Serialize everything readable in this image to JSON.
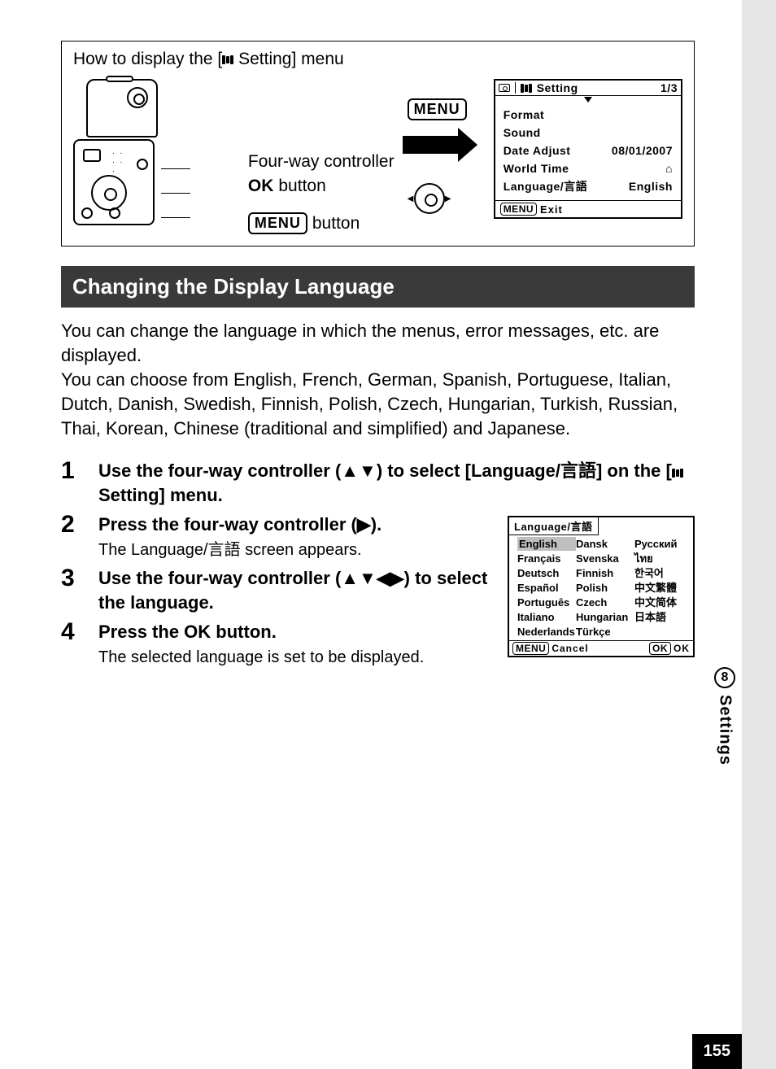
{
  "diagram": {
    "title_prefix": "How to display the [",
    "title_suffix": " Setting] menu",
    "controller_label": "Four-way controller",
    "ok_button_label": " button",
    "ok_glyph": "OK",
    "menu_button_label": " button",
    "menu_glyph": "MENU"
  },
  "setting_menu": {
    "title": "Setting",
    "page_indicator": "1/3",
    "items": {
      "format": "Format",
      "sound": "Sound",
      "date_adjust": "Date Adjust",
      "date_value": "08/01/2007",
      "world_time": "World Time",
      "language_label": "Language/言語",
      "language_value": "English"
    },
    "footer_label": "Exit",
    "footer_badge": "MENU"
  },
  "section_heading": "Changing the Display Language",
  "intro_p1": "You can change the language in which the menus, error messages, etc. are displayed.",
  "intro_p2": "You can choose from English, French, German, Spanish, Portuguese, Italian, Dutch, Danish, Swedish, Finnish, Polish, Czech, Hungarian, Turkish, Russian, Thai, Korean, Chinese (traditional and simplified) and Japanese.",
  "steps": {
    "s1": {
      "num": "1",
      "title_a": "Use the four-way controller (▲▼) to select [Language/",
      "title_b": "言語] on the [",
      "title_c": " Setting] menu."
    },
    "s2": {
      "num": "2",
      "title": "Press the four-way controller (▶).",
      "sub": "The Language/言語 screen appears."
    },
    "s3": {
      "num": "3",
      "title": "Use the four-way controller (▲▼◀▶) to select the language."
    },
    "s4": {
      "num": "4",
      "title_a": "Press the ",
      "title_b": " button.",
      "ok": "OK",
      "sub": "The selected language is set to be displayed."
    }
  },
  "lang_screen": {
    "header": "Language/言語",
    "col1": [
      "English",
      "Français",
      "Deutsch",
      "Español",
      "Português",
      "Italiano",
      "Nederlands"
    ],
    "col2": [
      "Dansk",
      "Svenska",
      "Finnish",
      "Polish",
      "Czech",
      "Hungarian",
      "Türkçe"
    ],
    "col3": [
      "Русский",
      "ไทย",
      "한국어",
      "中文繁體",
      "中文简体",
      "日本語",
      ""
    ],
    "footer_cancel": "Cancel",
    "footer_menu_badge": "MENU",
    "footer_ok_badge": "OK",
    "footer_ok": "OK"
  },
  "side": {
    "chapter_num": "8",
    "chapter_label": "Settings"
  },
  "page_number": "155"
}
